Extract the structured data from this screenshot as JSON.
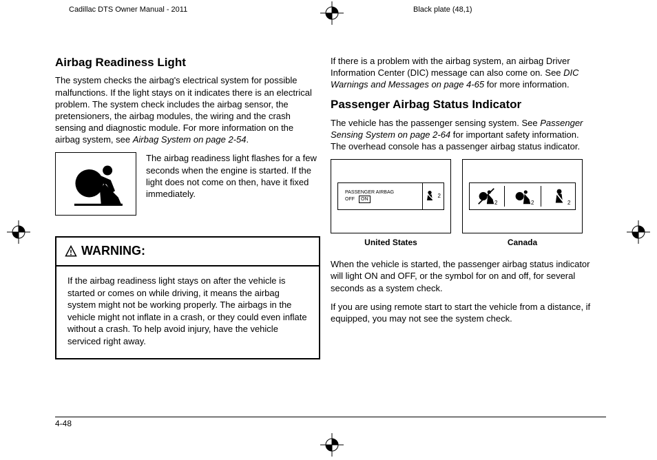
{
  "header": {
    "left": "Cadillac DTS Owner Manual - 2011",
    "right": "Black plate (48,1)"
  },
  "left_col": {
    "h1": "Airbag Readiness Light",
    "p1": "The system checks the airbag's electrical system for possible malfunctions. If the light stays on it indicates there is an electrical problem. The system check includes the airbag sensor, the pretensioners, the airbag modules, the wiring and the crash sensing and diagnostic module. For more information on the airbag system, see ",
    "p1_ref": "Airbag System on page 2-54",
    "p1_end": ".",
    "icon_txt": "The airbag readiness light flashes for a few seconds when the engine is started. If the light does not come on then, have it fixed immediately.",
    "warn_title": "WARNING:",
    "warn_body": "If the airbag readiness light stays on after the vehicle is started or comes on while driving, it means the airbag system might not be working properly. The airbags in the vehicle might not inflate in a crash, or they could even inflate without a crash. To help avoid injury, have the vehicle serviced right away."
  },
  "right_col": {
    "p0a": "If there is a problem with the airbag system, an airbag Driver Information Center (DIC) message can also come on. See ",
    "p0_ref": "DIC Warnings and Messages on page 4-65",
    "p0b": " for more information.",
    "h1": "Passenger Airbag Status Indicator",
    "p1a": "The vehicle has the passenger sensing system. See ",
    "p1_ref": "Passenger Sensing System on page 2-64",
    "p1b": " for important safety information. The overhead console has a passenger airbag status indicator.",
    "us_label": "United States",
    "ca_label": "Canada",
    "us_inner_line1": "PASSENGER AIRBAG",
    "us_inner_off": "OFF",
    "us_inner_on": "ON",
    "sub2": "2",
    "p2": "When the vehicle is started, the passenger airbag status indicator will light ON and OFF, or the symbol for on and off, for several seconds as a system check.",
    "p3": "If you are using remote start to start the vehicle from a distance, if equipped, you may not see the system check."
  },
  "page_num": "4-48"
}
